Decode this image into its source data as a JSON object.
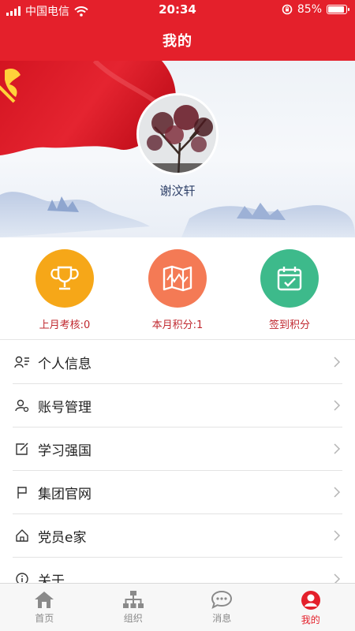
{
  "status_bar": {
    "carrier": "中国电信",
    "time": "20:34",
    "battery": "85%",
    "battery_level": 0.85
  },
  "nav": {
    "title": "我的"
  },
  "profile": {
    "name": "谢汶轩"
  },
  "stats": [
    {
      "label": "上月考核:0",
      "icon": "trophy-icon",
      "color": "#f6a718"
    },
    {
      "label": "本月积分:1",
      "icon": "map-icon",
      "color": "#f47a55"
    },
    {
      "label": "签到积分",
      "icon": "calendar-check-icon",
      "color": "#3dba8b"
    }
  ],
  "menu": [
    {
      "label": "个人信息",
      "icon": "user-card-icon"
    },
    {
      "label": "账号管理",
      "icon": "account-icon"
    },
    {
      "label": "学习强国",
      "icon": "edit-icon"
    },
    {
      "label": "集团官网",
      "icon": "flag-icon"
    },
    {
      "label": "党员e家",
      "icon": "home-icon"
    },
    {
      "label": "关于",
      "icon": "info-icon"
    }
  ],
  "tabs": [
    {
      "label": "首页",
      "icon": "home-tab-icon",
      "active": false
    },
    {
      "label": "组织",
      "icon": "org-chart-icon",
      "active": false
    },
    {
      "label": "消息",
      "icon": "message-icon",
      "active": false
    },
    {
      "label": "我的",
      "icon": "profile-tab-icon",
      "active": true
    }
  ],
  "colors": {
    "brand_red": "#e4202b",
    "stat_label": "#c0282f",
    "inactive": "#8a8a8a"
  }
}
